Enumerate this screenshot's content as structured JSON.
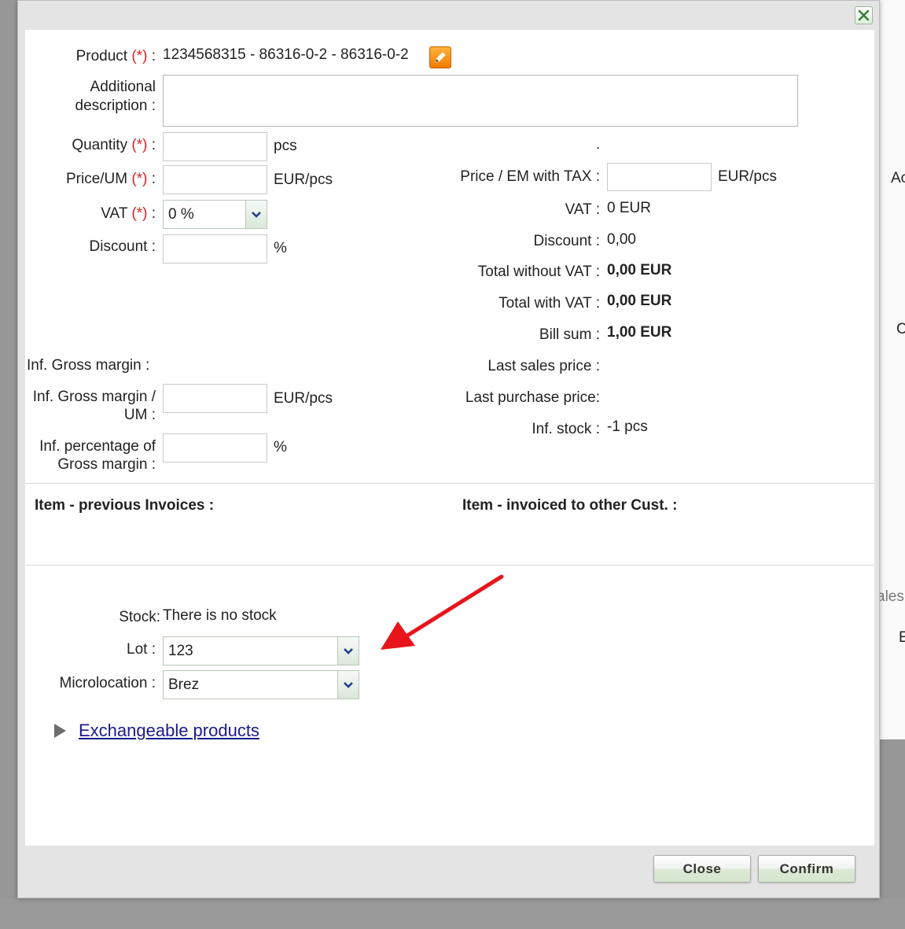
{
  "background": {
    "edge_texts": [
      "Ac",
      "C",
      "ales",
      "E"
    ]
  },
  "form": {
    "product_label": "Product",
    "required_marker": "(*)",
    "colon": ":",
    "product_value": "1234568315 - 86316-0-2 - 86316-0-2",
    "additional_desc_line1": "Additional",
    "additional_desc_line2": "description :",
    "additional_desc_value": "",
    "quantity_label": "Quantity",
    "quantity_value": "",
    "quantity_unit": "pcs",
    "price_um_label": "Price/UM",
    "price_um_value": "",
    "price_um_unit": "EUR/pcs",
    "vat_label": "VAT",
    "vat_selected": "0 %",
    "discount_label": "Discount :",
    "discount_value": "",
    "discount_unit": "%",
    "gross_margin_label": "Inf. Gross margin :",
    "gross_margin_um_line1": "Inf. Gross margin /",
    "gross_margin_um_line2": "UM :",
    "gross_margin_um_value": "",
    "gross_margin_um_unit": "EUR/pcs",
    "gross_margin_pct_line1": "Inf. percentage of",
    "gross_margin_pct_line2": "Gross margin :",
    "gross_margin_pct_value": "",
    "gross_margin_pct_unit": "%"
  },
  "summary": {
    "dot": ".",
    "price_em_tax_label": "Price / EM with TAX :",
    "price_em_tax_value": "",
    "price_em_tax_unit": "EUR/pcs",
    "vat_label": "VAT :",
    "vat_value": "0 EUR",
    "discount_label": "Discount :",
    "discount_value": "0,00",
    "total_without_vat_label": "Total without VAT :",
    "total_without_vat_value": "0,00 EUR",
    "total_with_vat_label": "Total with VAT :",
    "total_with_vat_value": "0,00 EUR",
    "bill_sum_label": "Bill sum :",
    "bill_sum_value": "1,00 EUR",
    "last_sales_price_label": "Last sales price :",
    "last_purchase_price_label": "Last purchase price:",
    "inf_stock_label": "Inf. stock :",
    "inf_stock_value": "-1 pcs"
  },
  "sections": {
    "previous_invoices": "Item - previous Invoices :",
    "invoiced_other_cust": "Item - invoiced to other Cust. :"
  },
  "stock": {
    "stock_label": "Stock:",
    "stock_value": "There is no stock",
    "lot_label": "Lot :",
    "lot_selected": "123",
    "microlocation_label": "Microlocation :",
    "microlocation_selected": "Brez",
    "exchangeable_link": "Exchangeable products"
  },
  "buttons": {
    "close": "Close",
    "confirm": "Confirm"
  },
  "colors": {
    "required": "#e02020",
    "annotation_arrow": "#e8141b",
    "link": "#1a1a8c"
  },
  "icons": {
    "dialog_close": "close-x-icon",
    "edit": "pencil-icon",
    "dropdown": "chevron-down-icon",
    "expand": "triangle-right-icon",
    "annotation": "red-arrow-icon"
  }
}
